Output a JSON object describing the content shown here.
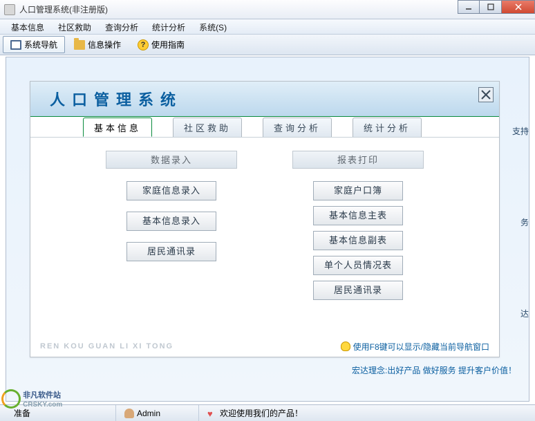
{
  "window": {
    "title": "人口管理系统(非注册版)"
  },
  "menu": [
    "基本信息",
    "社区救助",
    "查询分析",
    "统计分析",
    "系统(S)"
  ],
  "toolbar": [
    {
      "label": "系统导航",
      "icon": "monitor",
      "active": true
    },
    {
      "label": "信息操作",
      "icon": "folder",
      "active": false
    },
    {
      "label": "使用指南",
      "icon": "help",
      "active": false
    }
  ],
  "panel": {
    "title": "人口管理系统",
    "tabs": [
      "基本信息",
      "社区救助",
      "查询分析",
      "统计分析"
    ],
    "active_tab": 0,
    "cols": [
      {
        "head": "数据录入",
        "buttons": [
          "家庭信息录入",
          "基本信息录入",
          "居民通讯录"
        ]
      },
      {
        "head": "报表打印",
        "buttons": [
          "家庭户口簿",
          "基本信息主表",
          "基本信息副表",
          "单个人员情况表",
          "居民通讯录"
        ]
      }
    ],
    "pinyin": "REN KOU GUAN LI XI TONG",
    "hint": "使用F8键可以显示/隐藏当前导航窗口"
  },
  "edge": {
    "t1": "支持",
    "t2": "务",
    "t3": "达"
  },
  "slogan": "宏达理念:出好产品  做好服务  提升客户价值！",
  "status": {
    "ready": "准备",
    "user": "Admin",
    "welcome": "欢迎使用我们的产品！"
  },
  "watermark": {
    "name": "非凡软件站",
    "url": "CRSKY.com"
  }
}
